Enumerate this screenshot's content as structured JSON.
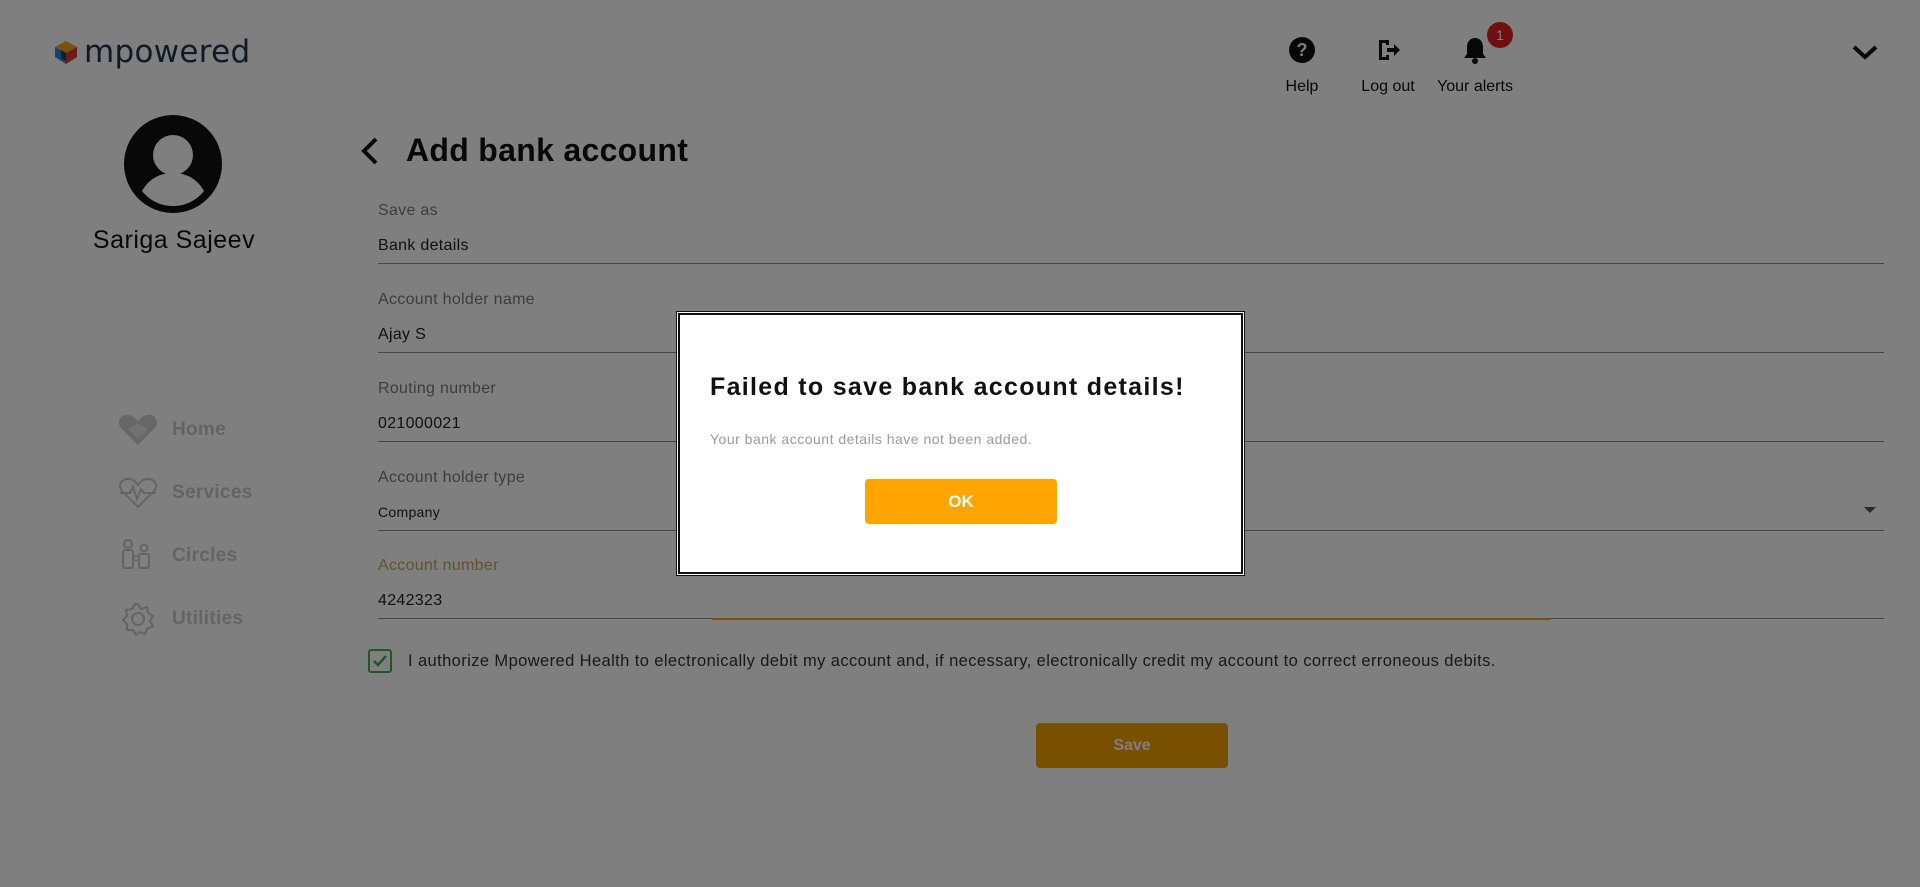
{
  "app": {
    "logo_text": "mpowered"
  },
  "header": {
    "help_label": "Help",
    "logout_label": "Log out",
    "alerts_label": "Your alerts",
    "alerts_count": "1"
  },
  "user": {
    "name": "Sariga Sajeev"
  },
  "nav": {
    "items": [
      {
        "label": "Home",
        "icon": "heart-home-icon"
      },
      {
        "label": "Services",
        "icon": "heart-pulse-icon"
      },
      {
        "label": "Circles",
        "icon": "people-icon"
      },
      {
        "label": "Utilities",
        "icon": "gear-icon"
      }
    ]
  },
  "page": {
    "title": "Add bank account"
  },
  "form": {
    "save_as": {
      "label": "Save as",
      "value": "Bank details"
    },
    "account_holder_name": {
      "label": "Account holder name",
      "value": "Ajay S"
    },
    "routing_number": {
      "label": "Routing number",
      "value": "021000021"
    },
    "account_holder_type": {
      "label": "Account holder type",
      "value": "Company"
    },
    "account_number": {
      "label": "Account number",
      "value": "4242323"
    },
    "consent_text": "I authorize Mpowered Health to electronically debit my account and, if necessary, electronically credit my account to correct erroneous debits.",
    "consent_checked": true,
    "save_label": "Save"
  },
  "modal": {
    "title": "Failed to save bank account details!",
    "message": "Your bank account details have not been added.",
    "ok_label": "OK"
  },
  "colors": {
    "accent": "#ffa400",
    "checkbox": "#39b54a",
    "badge": "#e0201d",
    "overlay": "rgba(0,0,0,0.5)"
  }
}
